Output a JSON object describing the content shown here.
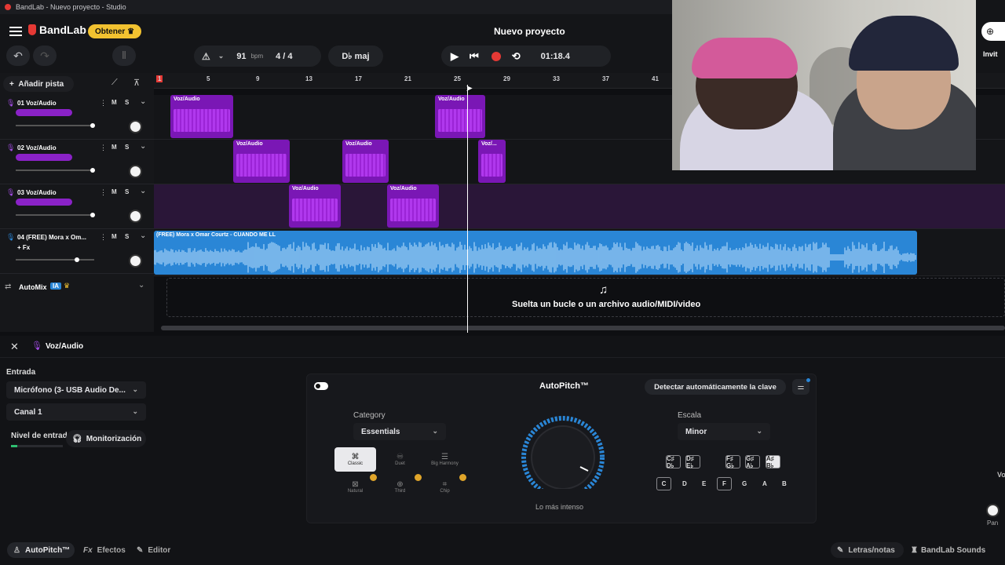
{
  "window": {
    "title": "BandLab - Nuevo proyecto - Studio"
  },
  "header": {
    "logo": "BandLab",
    "upgrade_label": "Obtener",
    "project_title": "Nuevo proyecto",
    "bpm_value": "91",
    "bpm_unit": "bpm",
    "time_signature": "4 / 4",
    "key": "D♭ maj",
    "time_display": "01:18.4"
  },
  "ruler": {
    "ticks": [
      "1",
      "5",
      "9",
      "13",
      "17",
      "21",
      "25",
      "29",
      "33",
      "37",
      "41"
    ]
  },
  "track_panel": {
    "add_track_label": "Añadir pista"
  },
  "tracks": [
    {
      "name": "01  Voz/Audio",
      "mute": "M",
      "solo": "S",
      "level": 0.98
    },
    {
      "name": "02  Voz/Audio",
      "mute": "M",
      "solo": "S",
      "level": 0.98
    },
    {
      "name": "03  Voz/Audio",
      "mute": "M",
      "solo": "S",
      "level": 0.98
    },
    {
      "name": "04  (FREE) Mora x Om...",
      "mute": "M",
      "solo": "S",
      "fx": "+ Fx",
      "level": 0.78
    }
  ],
  "clips": {
    "track1": [
      "Voz/Audio",
      "Voz/Audio"
    ],
    "track2": [
      "Voz/Audio",
      "Voz/Audio",
      "Voz/..."
    ],
    "track3": [
      "Voz/Audio",
      "Voz/Audio"
    ],
    "track4": "(FREE) Mora x Omar Courtz - CUANDO ME LL"
  },
  "automix": {
    "label": "AutoMix",
    "badge": "IA"
  },
  "dropzone": {
    "text": "Suelta un bucle o un archivo audio/MIDI/video"
  },
  "inspector": {
    "track_label": "Voz/Audio",
    "input_label": "Entrada",
    "input_device": "Micrófono (3- USB Audio De...",
    "channel": "Canal 1",
    "input_level_label": "Nivel de entrada",
    "monitor_label": "Monitorización"
  },
  "autopitch": {
    "title": "AutoPitch™",
    "detect_key_label": "Detectar automáticamente la clave",
    "category_label": "Category",
    "category_value": "Essentials",
    "effects": [
      "Classic",
      "Duet",
      "Big Harmony",
      "Natural",
      "Third",
      "Chip"
    ],
    "knob_label": "Lo más intenso",
    "scale_label": "Escala",
    "scale_value": "Minor",
    "sharp_keys": [
      "C♯ D♭",
      "D♯ E♭",
      "F♯ G♭",
      "G♯ A♭",
      "A♯ B♭"
    ],
    "natural_keys": [
      "C",
      "D",
      "E",
      "F",
      "G",
      "A",
      "B"
    ]
  },
  "footer": {
    "tabs": [
      "AutoPitch™",
      "Efectos",
      "Editor"
    ],
    "right": [
      "Letras/notas",
      "BandLab Sounds"
    ]
  },
  "right_edge": {
    "invite": "Invit",
    "pan": "Pan",
    "vol": "Vo"
  },
  "colors": {
    "accent_purple": "#7a17b5",
    "audio_blue": "#2a86d6",
    "record_red": "#e53935",
    "upgrade_yellow": "#f2c230"
  }
}
